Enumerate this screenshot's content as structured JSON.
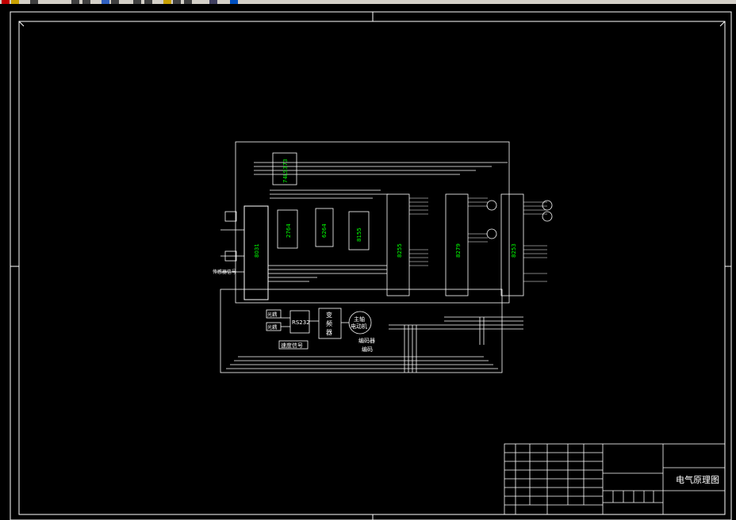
{
  "toolbar": {
    "buttons": [
      {
        "icon": "save-icon",
        "color": "#c00000"
      },
      {
        "icon": "open-icon",
        "color": "#c8a000"
      },
      {
        "icon": "print-icon",
        "color": "#404040"
      },
      {
        "icon": "cut-icon",
        "color": "#404040"
      },
      {
        "icon": "copy-icon",
        "color": "#404040"
      },
      {
        "icon": "zoom-icon",
        "color": "#3060c0"
      },
      {
        "icon": "pan-icon",
        "color": "#404040"
      },
      {
        "icon": "undo-icon",
        "color": "#404040"
      },
      {
        "icon": "redo-icon",
        "color": "#404040"
      },
      {
        "icon": "match-icon",
        "color": "#c8a000"
      },
      {
        "icon": "properties-icon",
        "color": "#404040"
      },
      {
        "icon": "layers-icon",
        "color": "#404040"
      },
      {
        "icon": "calculator-icon",
        "color": "#404060"
      },
      {
        "icon": "help-icon",
        "color": "#0050c0"
      }
    ]
  },
  "drawing": {
    "colors": {
      "background": "#000000",
      "lines": "#ffffff",
      "chip_labels": "#00ff00"
    },
    "labels": {
      "rs232": "RS232",
      "motor_line1": "主轴",
      "motor_line2": "电动机",
      "encoder_line1": "编码器",
      "encoder_line2": "编码",
      "driver_line1": "变",
      "driver_line2": "频",
      "driver_line3": "器",
      "speed_signal": "速度信号",
      "sensor_signal": "传感器信号",
      "block_a": "光耦",
      "block_b": "光耦"
    },
    "chips": [
      "8031",
      "74LS373",
      "2764",
      "6264",
      "8155",
      "8255",
      "8279",
      "8253"
    ]
  },
  "title_block": {
    "drawing_title": "电气原理图"
  }
}
